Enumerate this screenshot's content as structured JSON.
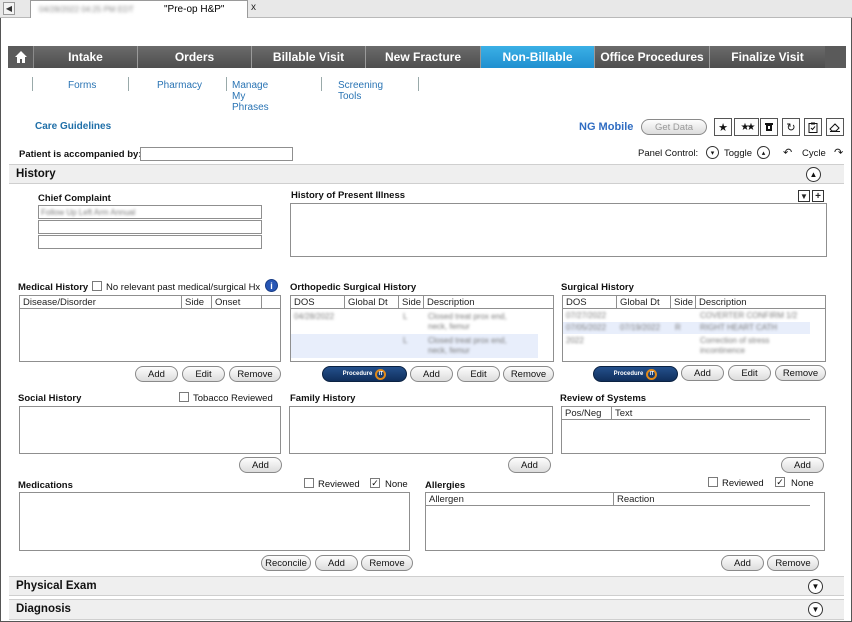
{
  "window_tab": {
    "blurred_text": "04/28/2022 04:25 PM EDT",
    "title": "\"Pre-op H&P\"",
    "close": "x"
  },
  "nav": {
    "home_icon": "home-icon",
    "items": [
      {
        "label": "Intake",
        "active": false
      },
      {
        "label": "Orders",
        "active": false
      },
      {
        "label": "Billable Visit",
        "active": false
      },
      {
        "label": "New Fracture",
        "active": false
      },
      {
        "label": "Non-Billable",
        "active": true
      },
      {
        "label": "Office Procedures",
        "active": false
      },
      {
        "label": "Finalize Visit",
        "active": false
      }
    ],
    "active_color": "#2a9fe0"
  },
  "subnav": {
    "items": [
      {
        "label": "Forms"
      },
      {
        "label": "Pharmacy"
      },
      {
        "label": "Manage My Phrases"
      },
      {
        "label": "Screening Tools"
      }
    ]
  },
  "care_guidelines": "Care Guidelines",
  "ng_mobile": "NG Mobile",
  "get_data": "Get Data",
  "toolbar_icons": [
    "star-icon",
    "double-star-icon",
    "trash-icon",
    "refresh-icon",
    "clipboard-icon",
    "eraser-icon"
  ],
  "accompanied_label": "Patient is accompanied by:",
  "panel_control": {
    "label": "Panel Control:",
    "toggle": "Toggle",
    "cycle": "Cycle"
  },
  "history": {
    "title": "History",
    "chief_complaint": {
      "label": "Chief Complaint",
      "value": "Follow Up Left Arm Annual"
    },
    "hpi": {
      "label": "History of Present Illness"
    },
    "medical_history": {
      "label": "Medical History",
      "no_relevant": "No relevant past medical/surgical Hx",
      "columns": [
        "Disease/Disorder",
        "Side",
        "Onset"
      ]
    },
    "ortho_surgical": {
      "label": "Orthopedic Surgical History",
      "columns": [
        "DOS",
        "Global Dt",
        "Side",
        "Description"
      ],
      "rows": [
        {
          "dos": "04/28/2022",
          "side": "L",
          "desc1": "Closed treat prox end,",
          "desc2": "neck, femur"
        },
        {
          "dos": "",
          "side": "L",
          "desc1": "Closed treat prox end,",
          "desc2": "neck, femur"
        }
      ]
    },
    "surgical": {
      "label": "Surgical History",
      "columns": [
        "DOS",
        "Global Dt",
        "Side",
        "Description"
      ],
      "rows": [
        {
          "dos": "07/27/2022",
          "gdt": "",
          "side": "",
          "desc": "COVERTER CONFIRM 1/2"
        },
        {
          "dos": "07/05/2022",
          "gdt": "07/19/2022",
          "side": "R",
          "desc": "RIGHT HEART CATH"
        },
        {
          "dos": "2022",
          "gdt": "",
          "side": "",
          "desc": "Correction of stress",
          "desc2": "incontinence"
        }
      ]
    },
    "procedure_label": "Procedure",
    "procedure_mark": "IT",
    "buttons": {
      "add": "Add",
      "edit": "Edit",
      "remove": "Remove"
    },
    "social": {
      "label": "Social History",
      "tobacco": "Tobacco Reviewed"
    },
    "family": {
      "label": "Family History"
    },
    "ros": {
      "label": "Review of Systems",
      "columns": [
        "Pos/Neg",
        "Text"
      ]
    },
    "medications": {
      "label": "Medications",
      "reviewed": "Reviewed",
      "none": "None",
      "reconcile": "Reconcile"
    },
    "allergies": {
      "label": "Allergies",
      "reviewed": "Reviewed",
      "none": "None",
      "columns": [
        "Allergen",
        "Reaction"
      ]
    }
  },
  "physical_exam": "Physical Exam",
  "diagnosis": "Diagnosis"
}
